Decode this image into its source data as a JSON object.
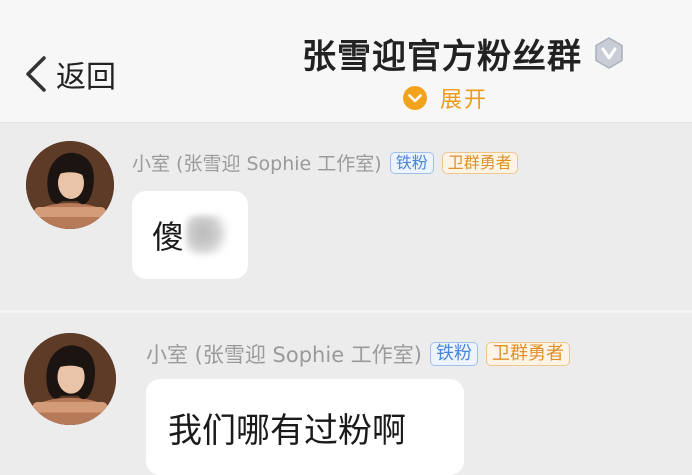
{
  "header": {
    "back_label": "返回",
    "title": "张雪迎官方粉丝群",
    "expand_label": "展开"
  },
  "messages": [
    {
      "sender": "小室 (张雪迎 Sophie 工作室)",
      "badges": [
        "铁粉",
        "卫群勇者"
      ],
      "text": "傻",
      "text_obscured": true
    },
    {
      "sender": "小室 (张雪迎 Sophie 工作室)",
      "badges": [
        "铁粉",
        "卫群勇者"
      ],
      "text": "我们哪有过粉啊"
    }
  ],
  "colors": {
    "accent_orange": "#f09a1a",
    "badge_blue": "#4a86d8",
    "badge_orange": "#e0902a",
    "background": "#ececec",
    "header_background": "#f7f7f7"
  },
  "icons": [
    "chevron-left-icon",
    "verified-icon",
    "chevron-down-icon"
  ]
}
